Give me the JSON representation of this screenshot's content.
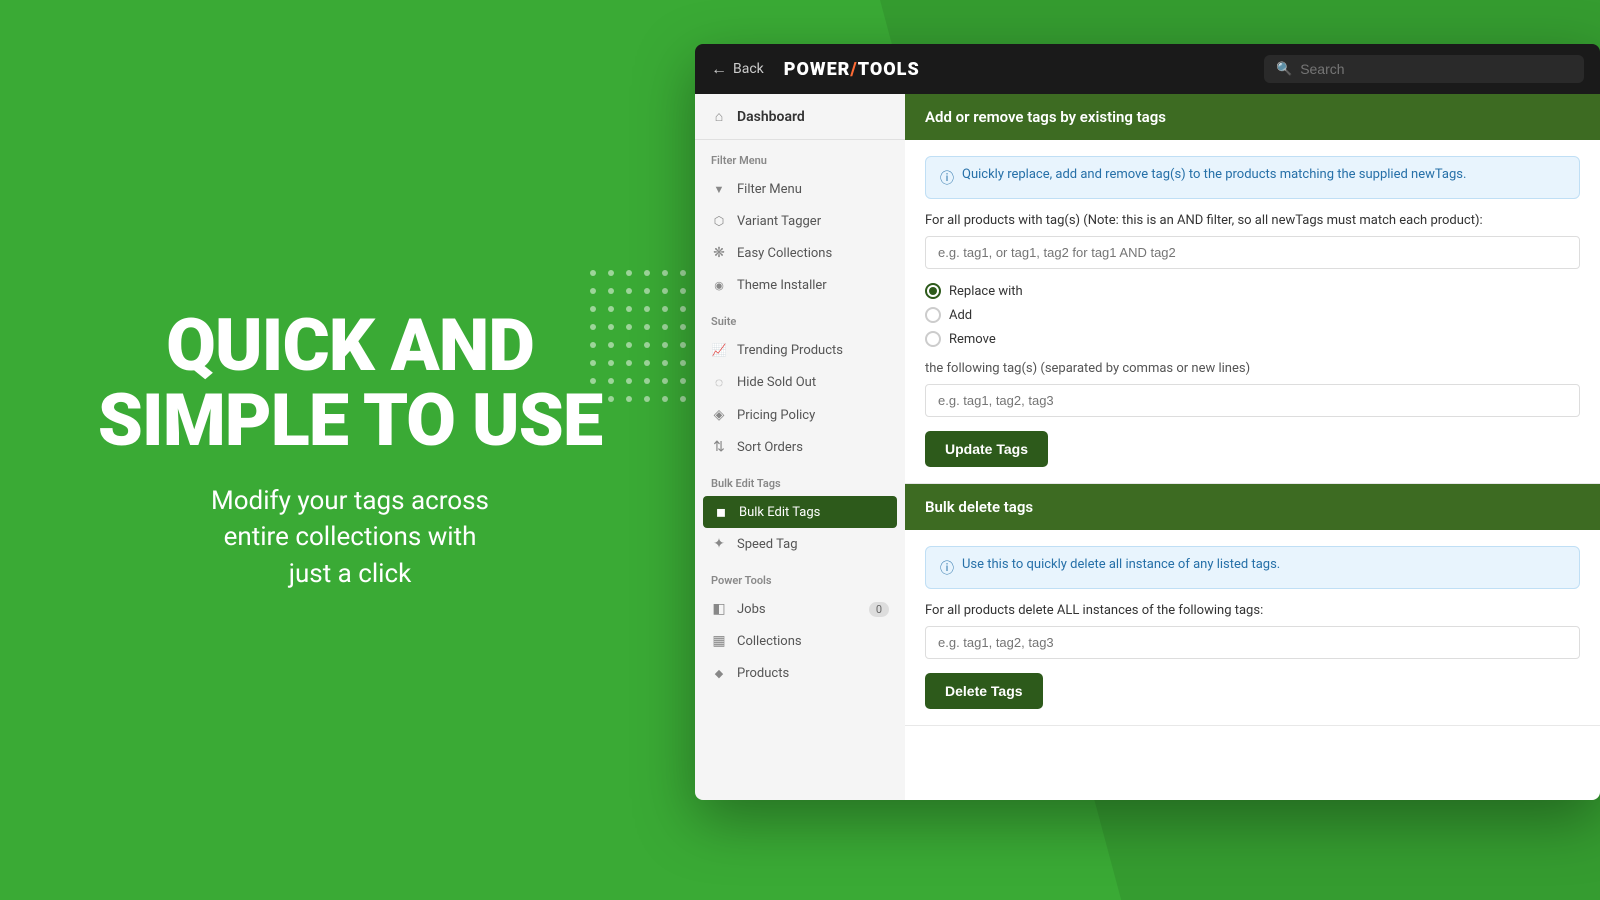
{
  "hero": {
    "title_line1": "QUICK AND",
    "title_line2": "SIMPLE TO USE",
    "subtitle": "Modify your tags across\nentire collections with\njust a click"
  },
  "topbar": {
    "back_label": "Back",
    "logo": "POWER",
    "logo_accent": "/",
    "logo_rest": "TOOLS",
    "search_placeholder": "Search"
  },
  "sidebar": {
    "dashboard_label": "Dashboard",
    "filter_menu_section": "Filter Menu",
    "filter_menu_items": [
      {
        "id": "filter-menu",
        "label": "Filter Menu"
      },
      {
        "id": "variant-tagger",
        "label": "Variant Tagger"
      },
      {
        "id": "easy-collections",
        "label": "Easy Collections"
      },
      {
        "id": "theme-installer",
        "label": "Theme Installer"
      }
    ],
    "suite_section": "Suite",
    "suite_items": [
      {
        "id": "trending-products",
        "label": "Trending Products"
      },
      {
        "id": "hide-sold-out",
        "label": "Hide Sold Out"
      },
      {
        "id": "pricing-policy",
        "label": "Pricing Policy"
      },
      {
        "id": "sort-orders",
        "label": "Sort Orders"
      }
    ],
    "bulk_edit_section": "Bulk Edit Tags",
    "bulk_edit_items": [
      {
        "id": "bulk-edit-tags",
        "label": "Bulk Edit Tags",
        "active": true
      },
      {
        "id": "speed-tag",
        "label": "Speed Tag"
      }
    ],
    "power_tools_section": "Power Tools",
    "power_tools_items": [
      {
        "id": "jobs",
        "label": "Jobs",
        "badge": "0"
      },
      {
        "id": "collections",
        "label": "Collections"
      },
      {
        "id": "products",
        "label": "Products"
      }
    ]
  },
  "panel": {
    "section1": {
      "header": "Add or remove tags by existing tags",
      "info_text": "Quickly replace, add and remove tag(s) to the products matching the supplied newTags.",
      "field1_label": "For all products with tag(s) (Note: this is an AND filter, so all newTags must match each product):",
      "field1_placeholder": "e.g. tag1, or tag1, tag2 for tag1 AND tag2",
      "radio_options": [
        {
          "id": "replace",
          "label": "Replace with",
          "checked": true
        },
        {
          "id": "add",
          "label": "Add",
          "checked": false
        },
        {
          "id": "remove",
          "label": "Remove",
          "checked": false
        }
      ],
      "field2_label": "the following tag(s) (separated by commas or new lines)",
      "field2_placeholder": "e.g. tag1, tag2, tag3",
      "button_label": "Update Tags"
    },
    "section2": {
      "header": "Bulk delete tags",
      "info_text": "Use this to quickly delete all instance of any listed tags.",
      "field_label": "For all products delete ALL instances of the following tags:",
      "field_placeholder": "e.g. tag1, tag2, tag3",
      "button_label": "Delete Tags"
    }
  }
}
